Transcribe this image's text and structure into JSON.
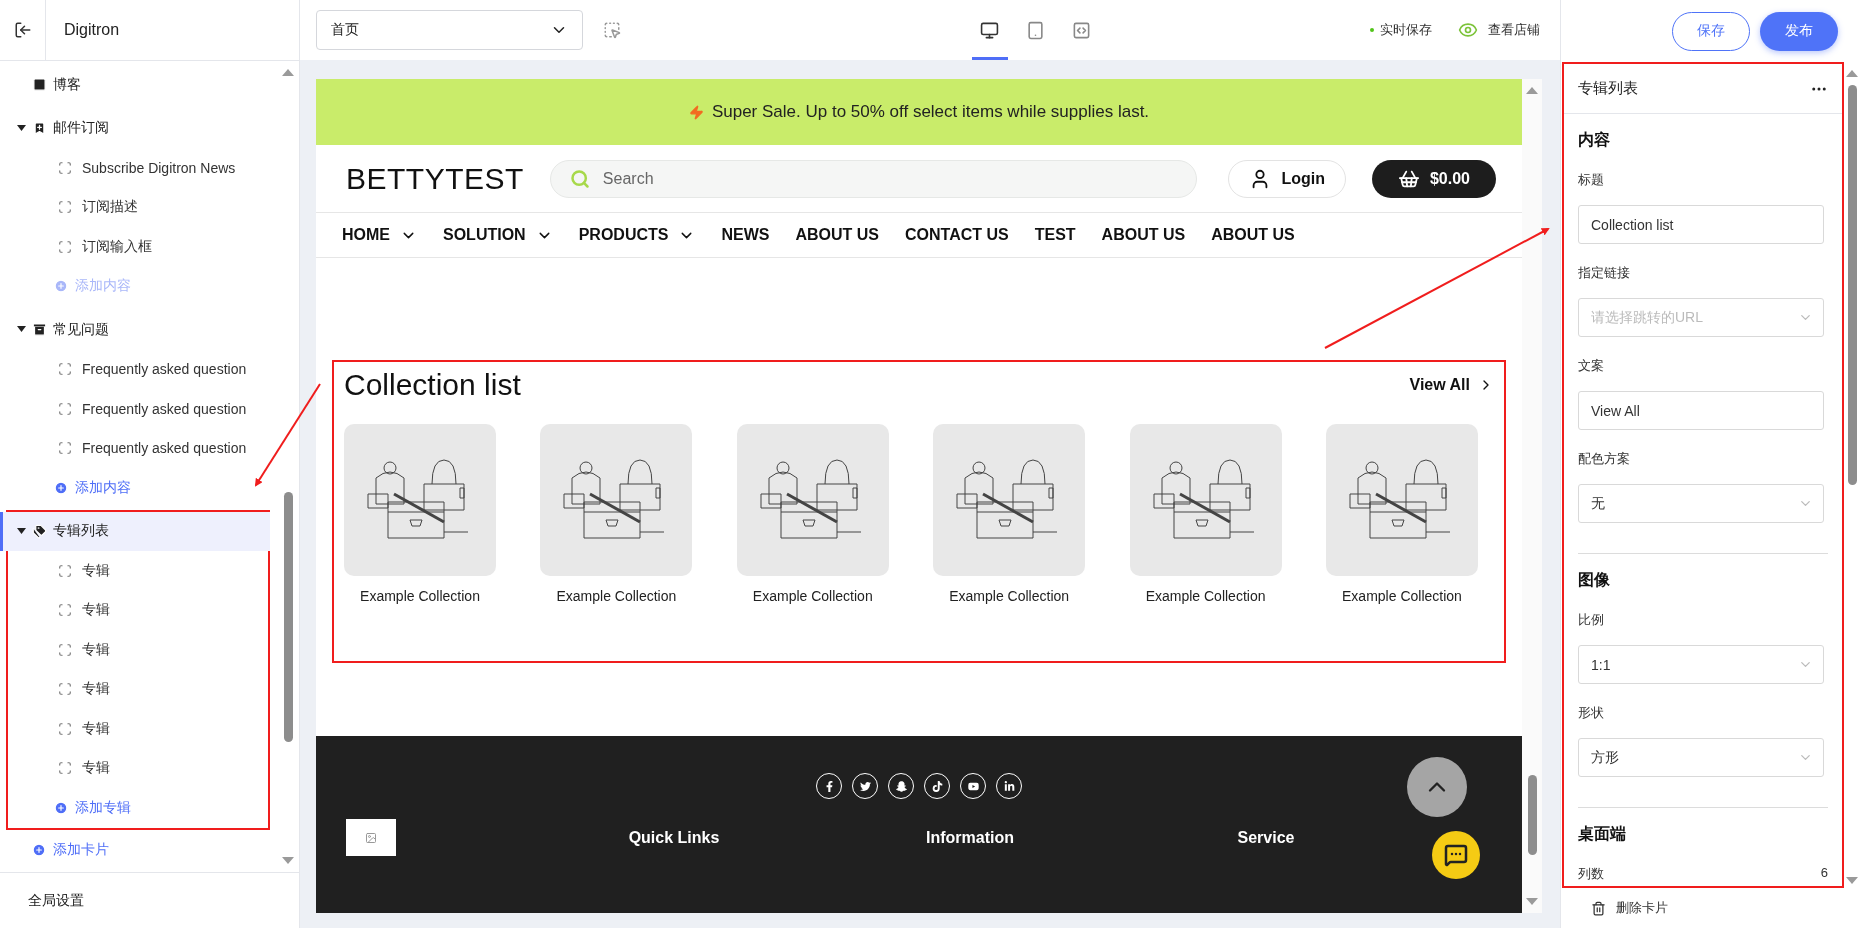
{
  "sidebar": {
    "title": "Digitron",
    "nodes": [
      {
        "label": "博客",
        "kind": "blog",
        "selected": false,
        "annotated": false
      },
      {
        "label": "邮件订阅",
        "kind": "mail",
        "expanded": true,
        "selected": false,
        "annotated": false,
        "children": [
          {
            "label": "Subscribe Digitron News"
          },
          {
            "label": "订阅描述"
          },
          {
            "label": "订阅输入框"
          }
        ],
        "add": {
          "label": "添加内容",
          "disabled": true
        }
      },
      {
        "label": "常见问题",
        "kind": "faq",
        "expanded": true,
        "selected": false,
        "annotated": false,
        "children": [
          {
            "label": "Frequently asked question"
          },
          {
            "label": "Frequently asked question"
          },
          {
            "label": "Frequently asked question"
          }
        ],
        "add": {
          "label": "添加内容",
          "disabled": false
        }
      },
      {
        "label": "专辑列表",
        "kind": "collection",
        "expanded": true,
        "selected": true,
        "annotated": true,
        "children": [
          {
            "label": "专辑"
          },
          {
            "label": "专辑"
          },
          {
            "label": "专辑"
          },
          {
            "label": "专辑"
          },
          {
            "label": "专辑"
          },
          {
            "label": "专辑"
          }
        ],
        "add": {
          "label": "添加专辑",
          "disabled": false
        }
      }
    ],
    "add_card": "添加卡片",
    "global_settings": "全局设置"
  },
  "toolbar": {
    "page_select": "首页",
    "devices": [
      {
        "kind": "desktop",
        "selected": true
      },
      {
        "kind": "tablet",
        "selected": false
      },
      {
        "kind": "code",
        "selected": false
      }
    ],
    "autosave": "实时保存",
    "view_store": "查看店铺",
    "save": "保存",
    "publish": "发布"
  },
  "preview": {
    "announcement": "Super Sale. Up to 50% off select items while supplies last.",
    "logo": "BETTYTEST",
    "search_placeholder": "Search",
    "login": "Login",
    "cart": "$0.00",
    "nav": [
      {
        "label": "HOME",
        "dropdown": true
      },
      {
        "label": "SOLUTION",
        "dropdown": true
      },
      {
        "label": "PRODUCTS",
        "dropdown": true
      },
      {
        "label": "NEWS",
        "dropdown": false
      },
      {
        "label": "ABOUT US",
        "dropdown": false
      },
      {
        "label": "CONTACT US",
        "dropdown": false
      },
      {
        "label": "TEST",
        "dropdown": false
      },
      {
        "label": "ABOUT US",
        "dropdown": false
      },
      {
        "label": "ABOUT US",
        "dropdown": false
      }
    ],
    "collection": {
      "title": "Collection list",
      "view_all": "View All",
      "annotated": true,
      "items": [
        {
          "caption": "Example Collection"
        },
        {
          "caption": "Example Collection"
        },
        {
          "caption": "Example Collection"
        },
        {
          "caption": "Example Collection"
        },
        {
          "caption": "Example Collection"
        },
        {
          "caption": "Example Collection"
        }
      ]
    },
    "footer": {
      "social": [
        {
          "kind": "facebook"
        },
        {
          "kind": "twitter"
        },
        {
          "kind": "snapchat"
        },
        {
          "kind": "tiktok"
        },
        {
          "kind": "youtube"
        },
        {
          "kind": "linkedin"
        }
      ],
      "columns": [
        "Quick Links",
        "Information",
        "Service"
      ]
    }
  },
  "settings": {
    "title": "专辑列表",
    "annotated": true,
    "sections": [
      {
        "heading": "内容",
        "fields": [
          {
            "label": "标题",
            "kind": "input",
            "value": "Collection list"
          },
          {
            "label": "指定链接",
            "kind": "select",
            "placeholder": "请选择跳转的URL"
          },
          {
            "label": "文案",
            "kind": "input",
            "value": "View All"
          },
          {
            "label": "配色方案",
            "kind": "select",
            "value": "无"
          }
        ]
      },
      {
        "heading": "图像",
        "fields": [
          {
            "label": "比例",
            "kind": "select",
            "value": "1:1"
          },
          {
            "label": "形状",
            "kind": "select",
            "value": "方形"
          }
        ]
      },
      {
        "heading": "桌面端",
        "fields": [
          {
            "label": "列数",
            "kind": "number",
            "value": "6"
          }
        ]
      }
    ],
    "delete": "删除卡片"
  }
}
